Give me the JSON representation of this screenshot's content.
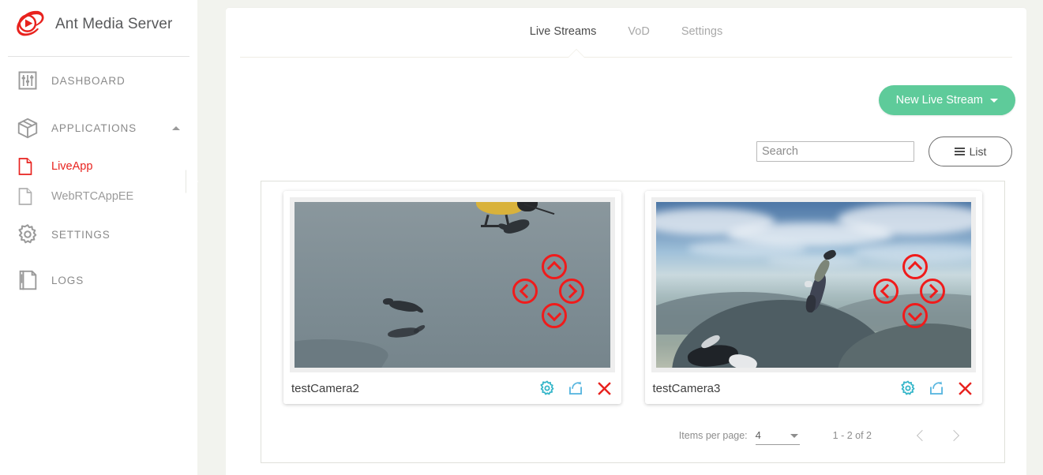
{
  "brand": {
    "name": "Ant Media Server",
    "logo_icon": "ant-media-logo-icon",
    "logo_color": "#e8221e"
  },
  "sidebar": {
    "items": [
      {
        "label": "DASHBOARD",
        "icon": "sliders-icon"
      },
      {
        "label": "APPLICATIONS",
        "icon": "box-icon",
        "caret": "chevron-up-icon"
      },
      {
        "label": "SETTINGS",
        "icon": "gear-icon"
      },
      {
        "label": "LOGS",
        "icon": "log-file-icon"
      }
    ],
    "applications": [
      {
        "label": "LiveApp",
        "icon": "file-icon",
        "active": true
      },
      {
        "label": "WebRTCAppEE",
        "icon": "file-icon",
        "active": false
      }
    ]
  },
  "tabs": [
    {
      "label": "Live Streams",
      "active": true
    },
    {
      "label": "VoD",
      "active": false
    },
    {
      "label": "Settings",
      "active": false
    }
  ],
  "toolbar": {
    "new_stream_label": "New Live Stream",
    "new_stream_caret": "caret-down-icon",
    "new_stream_color": "#5ecb9a",
    "list_label": "List",
    "list_icon": "hamburger-icon"
  },
  "search": {
    "placeholder": "Search",
    "value": ""
  },
  "streams": [
    {
      "name": "testCamera2",
      "thumbnail": "skydivers-helicopter-grey-sky",
      "ptz": {
        "up": "chevron-up-circle-icon",
        "down": "chevron-down-circle-icon",
        "left": "chevron-left-circle-icon",
        "right": "chevron-right-circle-icon",
        "color": "#f01b1b"
      },
      "actions": [
        {
          "name": "settings",
          "icon": "gear-icon",
          "color": "#35b6c9"
        },
        {
          "name": "publish",
          "icon": "share-icon",
          "color": "#5bb7e0"
        },
        {
          "name": "delete",
          "icon": "close-x-icon",
          "color": "#e8221e"
        }
      ]
    },
    {
      "name": "testCamera3",
      "thumbnail": "skydiver-aerial-mountains",
      "ptz": {
        "up": "chevron-up-circle-icon",
        "down": "chevron-down-circle-icon",
        "left": "chevron-left-circle-icon",
        "right": "chevron-right-circle-icon",
        "color": "#f01b1b"
      },
      "actions": [
        {
          "name": "settings",
          "icon": "gear-icon",
          "color": "#35b6c9"
        },
        {
          "name": "publish",
          "icon": "share-icon",
          "color": "#5bb7e0"
        },
        {
          "name": "delete",
          "icon": "close-x-icon",
          "color": "#e8221e"
        }
      ]
    }
  ],
  "paginator": {
    "items_per_page_label": "Items per page:",
    "items_per_page_value": "4",
    "range_label": "1 - 2 of 2",
    "prev_icon": "chevron-left-icon",
    "next_icon": "chevron-right-icon"
  }
}
